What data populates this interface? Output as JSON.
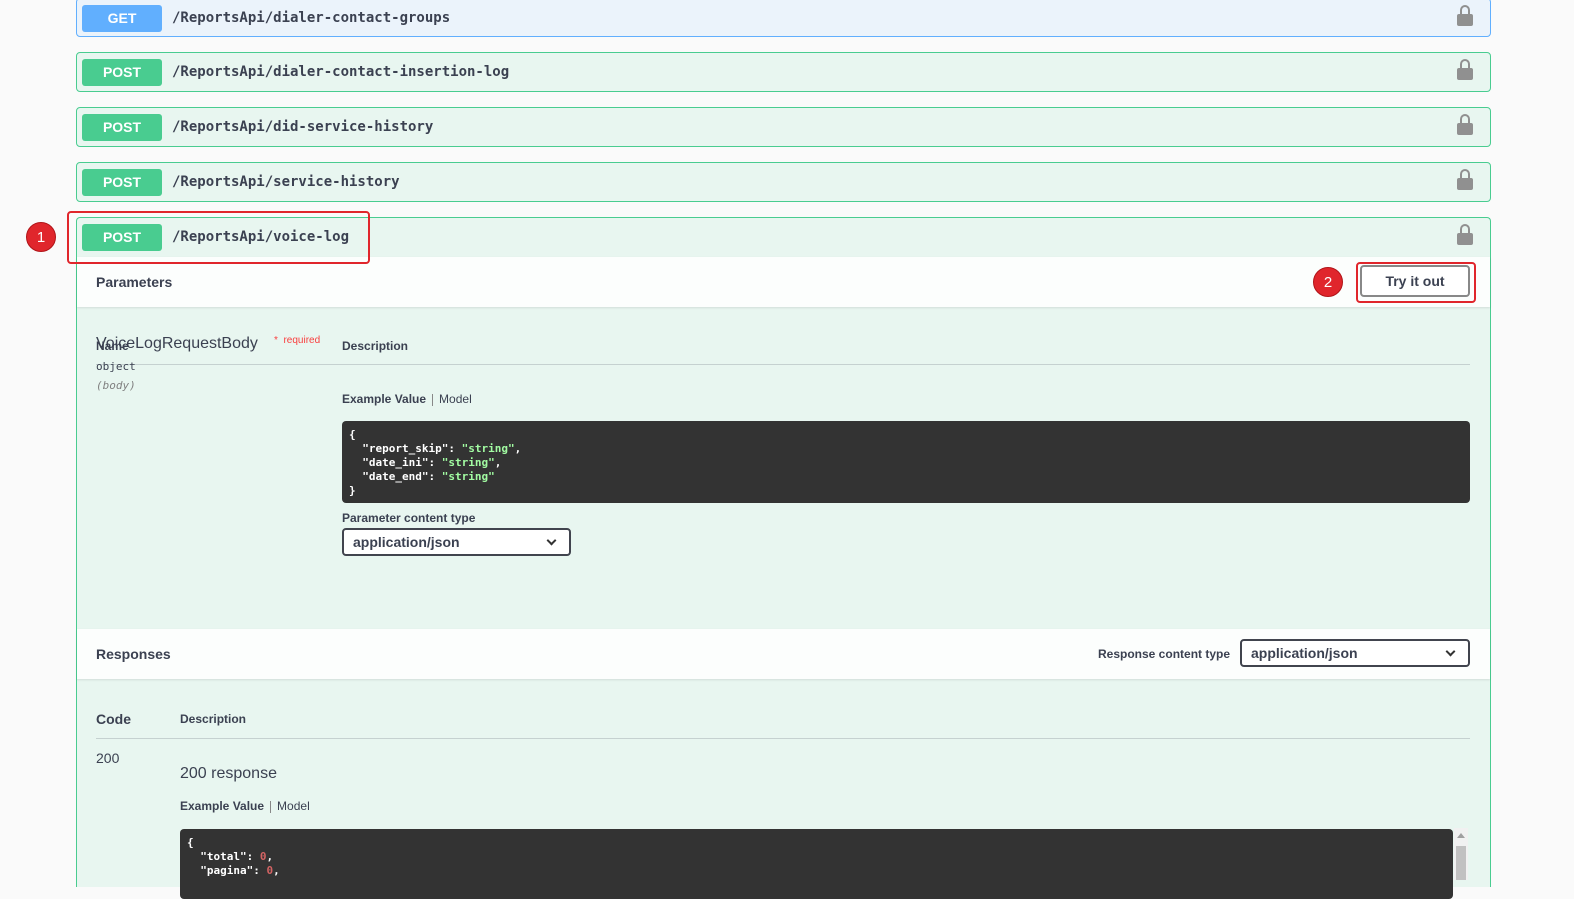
{
  "operations": [
    {
      "method": "GET",
      "path": "/ReportsApi/dialer-contact-groups"
    },
    {
      "method": "POST",
      "path": "/ReportsApi/dialer-contact-insertion-log"
    },
    {
      "method": "POST",
      "path": "/ReportsApi/did-service-history"
    },
    {
      "method": "POST",
      "path": "/ReportsApi/service-history"
    },
    {
      "method": "POST",
      "path": "/ReportsApi/voice-log"
    }
  ],
  "parameters": {
    "title": "Parameters",
    "try_button": "Try it out",
    "col_name": "Name",
    "col_description": "Description",
    "param_name": "VoiceLogRequestBody",
    "required_star": "*",
    "required_text": "required",
    "param_type": "object",
    "param_in": "(body)",
    "tab_example": "Example Value",
    "tab_model": "Model",
    "example_lines": [
      {
        "pre": "{",
        "key": "",
        "val": "",
        "post": ""
      },
      {
        "pre": "  ",
        "key": "\"report_skip\"",
        "val": "\"string\"",
        "post": ","
      },
      {
        "pre": "  ",
        "key": "\"date_ini\"",
        "val": "\"string\"",
        "post": ","
      },
      {
        "pre": "  ",
        "key": "\"date_end\"",
        "val": "\"string\"",
        "post": ""
      },
      {
        "pre": "}",
        "key": "",
        "val": "",
        "post": ""
      }
    ],
    "content_type_label": "Parameter content type",
    "content_type_value": "application/json"
  },
  "responses": {
    "title": "Responses",
    "content_type_label": "Response content type",
    "content_type_value": "application/json",
    "col_code": "Code",
    "col_description": "Description",
    "code": "200",
    "description": "200 response",
    "tab_example": "Example Value",
    "tab_model": "Model",
    "example_lines": [
      {
        "pre": "{",
        "key": "",
        "val": "",
        "post": ""
      },
      {
        "pre": "  ",
        "key": "\"total\"",
        "val": "0",
        "post": ","
      },
      {
        "pre": "  ",
        "key": "\"pagina\"",
        "val": "0",
        "post": ","
      }
    ]
  },
  "annotations": {
    "step1": "1",
    "step2": "2",
    "color": "#e0262c"
  },
  "colors": {
    "post": "#49cc90",
    "get": "#61affe"
  }
}
